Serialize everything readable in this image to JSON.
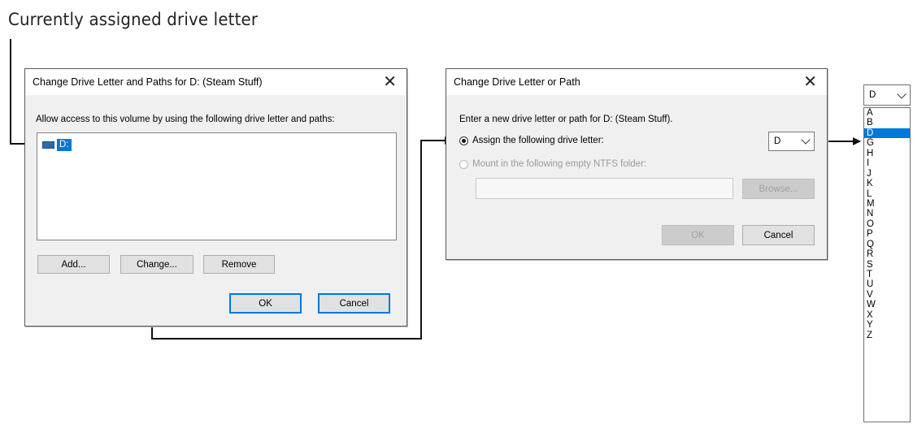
{
  "annotation": {
    "text": "Currently assigned drive letter"
  },
  "dialog1": {
    "title": "Change Drive Letter and Paths for D: (Steam Stuff)",
    "instructions": "Allow access to this volume by using the following drive letter and paths:",
    "entries": [
      {
        "label": "D:"
      }
    ],
    "buttons": {
      "add": "Add...",
      "change": "Change...",
      "remove": "Remove",
      "ok": "OK",
      "cancel": "Cancel"
    }
  },
  "dialog2": {
    "title": "Change Drive Letter or Path",
    "instructions": "Enter a new drive letter or path for D: (Steam Stuff).",
    "assign_label": "Assign the following drive letter:",
    "assign_selected": true,
    "drive_combo_value": "D",
    "mount_label": "Mount in the following empty NTFS folder:",
    "mount_path_value": "",
    "buttons": {
      "browse": "Browse...",
      "ok": "OK",
      "cancel": "Cancel"
    }
  },
  "dropdown": {
    "value": "D",
    "options": [
      "A",
      "B",
      "D",
      "G",
      "H",
      "I",
      "J",
      "K",
      "L",
      "M",
      "N",
      "O",
      "P",
      "Q",
      "R",
      "S",
      "T",
      "U",
      "V",
      "W",
      "X",
      "Y",
      "Z"
    ],
    "selected": "D"
  },
  "icons": {
    "close": "close-icon",
    "drive": "drive-icon",
    "chevron": "chevron-down-icon",
    "arrow": "arrow-icon"
  },
  "colors": {
    "selection": "#0078d7",
    "dialog_bg": "#f0f0f0",
    "default_button_border": "#0078d7"
  }
}
